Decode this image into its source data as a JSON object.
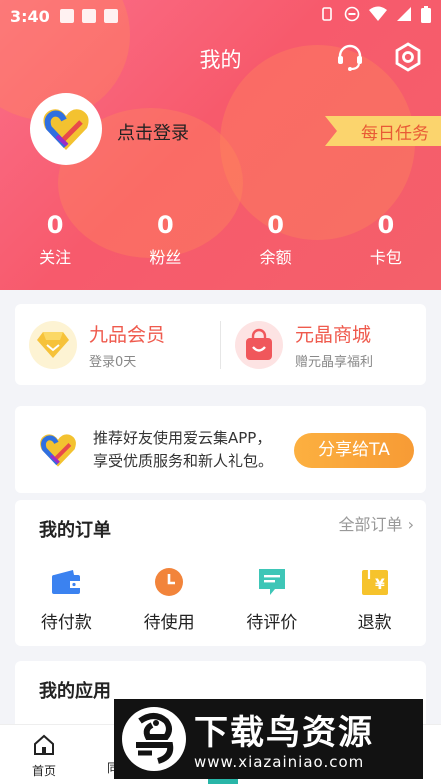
{
  "status_bar": {
    "time": "3:40"
  },
  "header": {
    "title": "我的"
  },
  "user": {
    "login_label": "点击登录",
    "daily_task_label": "每日任务"
  },
  "stats": [
    {
      "value": "0",
      "label": "关注"
    },
    {
      "value": "0",
      "label": "粉丝"
    },
    {
      "value": "0",
      "label": "余额"
    },
    {
      "value": "0",
      "label": "卡包"
    }
  ],
  "member": {
    "vip": {
      "title": "九品会员",
      "subtitle": "登录0天",
      "icon": "diamond-icon"
    },
    "mall": {
      "title": "元晶商城",
      "subtitle": "赠元晶享福利",
      "icon": "shopping-bag-icon"
    }
  },
  "share": {
    "text_line1": "推荐好友使用爱云集APP，",
    "text_line2": "享受优质服务和新人礼包。",
    "button_label": "分享给TA"
  },
  "orders": {
    "title": "我的订单",
    "all_label": "全部订单 ›",
    "items": [
      {
        "label": "待付款",
        "icon": "wallet-icon",
        "color": "#3b82f0"
      },
      {
        "label": "待使用",
        "icon": "clock-icon",
        "color": "#f2843b"
      },
      {
        "label": "待评价",
        "icon": "comment-icon",
        "color": "#3ec6b7"
      },
      {
        "label": "退款",
        "icon": "refund-icon",
        "color": "#f6c32c"
      }
    ]
  },
  "apps": {
    "title": "我的应用"
  },
  "bottom_nav": {
    "home_label": "首页",
    "second_label": "同"
  },
  "watermark": {
    "title": "下载鸟资源",
    "url": "www.xiazainiao.com"
  },
  "colors": {
    "brand": "#f75a6c",
    "accent_orange": "#f79b35",
    "title_red": "#ef5a4d"
  }
}
